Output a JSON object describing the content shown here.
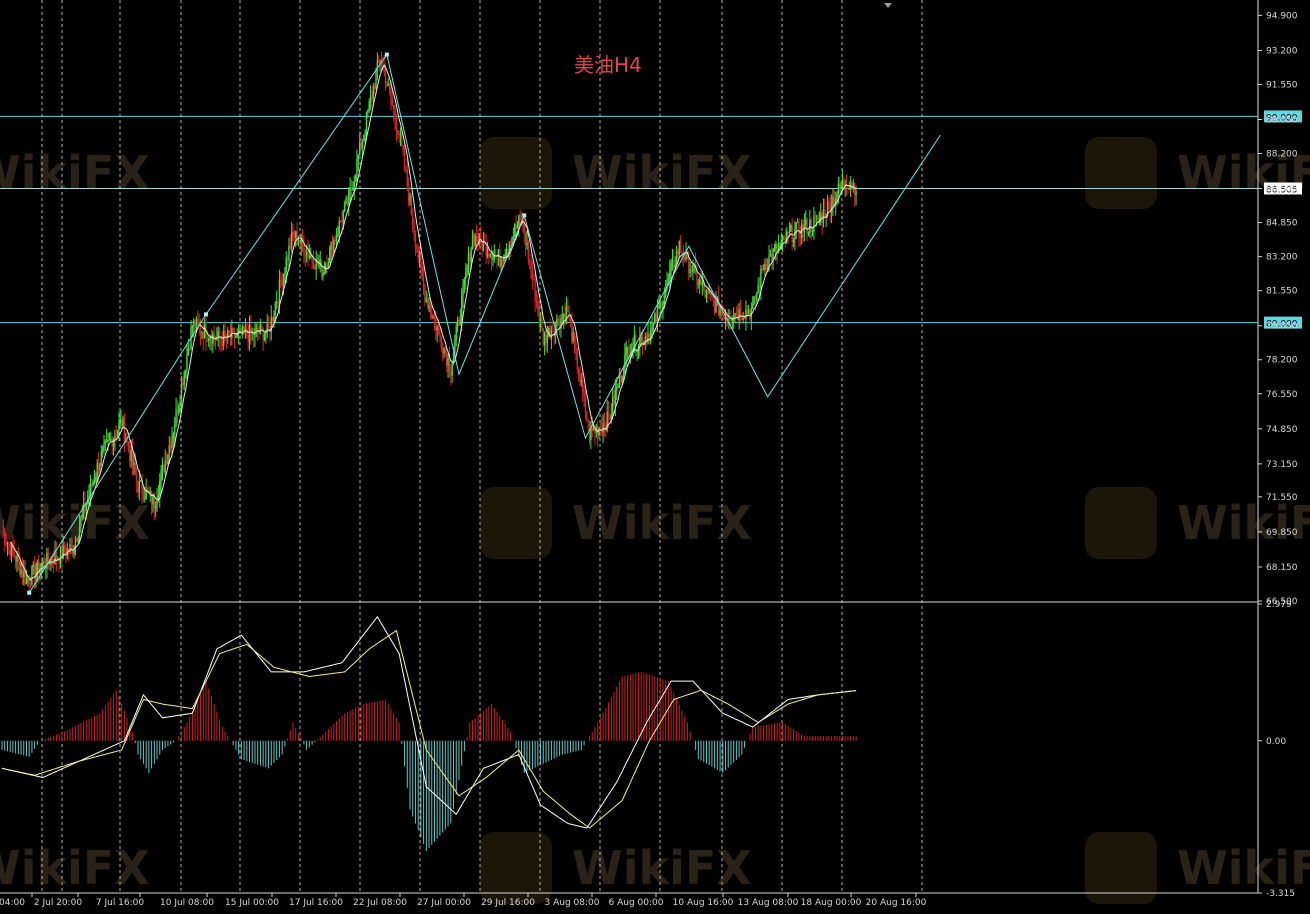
{
  "chart_data": {
    "type": "candlestick",
    "title": "美油H4",
    "colors": {
      "bull": "#3fe13a",
      "bear": "#e0202a",
      "zigzag": "#67e6e6",
      "ma": "#d7f5d7",
      "hline": "#5fd6e0",
      "grid": "#d0d0d0",
      "histogram_pos": "#d11e1e",
      "histogram_neg": "#5ec8c8",
      "macd": "#ffffff",
      "signal": "#f5f08a"
    },
    "price_axis": {
      "ticks": [
        "94.900",
        "93.200",
        "91.550",
        "89.850",
        "88.200",
        "86.505",
        "84.850",
        "83.200",
        "81.550",
        "79.850",
        "78.200",
        "76.550",
        "74.850",
        "73.150",
        "71.550",
        "69.850",
        "68.150",
        "66.500"
      ],
      "range": [
        66.5,
        95.5
      ]
    },
    "horizontal_lines": [
      {
        "value": 90.0,
        "label": "90.000"
      },
      {
        "value": 86.505,
        "label": "86.505"
      },
      {
        "value": 80.0,
        "label": "80.000"
      }
    ],
    "time_axis": {
      "labels": [
        "04:00",
        "2 Jul 20:00",
        "7 Jul 16:00",
        "10 Jul 08:00",
        "15 Jul 00:00",
        "17 Jul 16:00",
        "22 Jul 08:00",
        "27 Jul 00:00",
        "29 Jul 16:00",
        "3 Aug 08:00",
        "6 Aug 00:00",
        "10 Aug 16:00",
        "13 Aug 08:00",
        "18 Aug 00:00",
        "20 Aug 16:00"
      ],
      "label_positions": [
        0,
        24,
        72,
        120,
        168,
        216,
        264,
        312,
        360,
        408,
        456,
        504,
        552,
        600,
        648
      ]
    },
    "price_swings": [
      [
        0,
        69.9
      ],
      [
        18,
        67.5
      ],
      [
        30,
        68.3
      ],
      [
        52,
        69.1
      ],
      [
        72,
        73.4
      ],
      [
        88,
        75.2
      ],
      [
        100,
        72.1
      ],
      [
        112,
        71.3
      ],
      [
        126,
        74.8
      ],
      [
        140,
        79.9
      ],
      [
        160,
        79.2
      ],
      [
        196,
        79.6
      ],
      [
        214,
        84.3
      ],
      [
        236,
        82.5
      ],
      [
        256,
        86.2
      ],
      [
        278,
        92.9
      ],
      [
        292,
        89.2
      ],
      [
        310,
        81.6
      ],
      [
        330,
        77.8
      ],
      [
        346,
        84.2
      ],
      [
        366,
        83.1
      ],
      [
        382,
        85.1
      ],
      [
        398,
        79.2
      ],
      [
        416,
        80.6
      ],
      [
        432,
        74.6
      ],
      [
        446,
        75.3
      ],
      [
        460,
        78.7
      ],
      [
        478,
        79.6
      ],
      [
        498,
        83.7
      ],
      [
        518,
        81.3
      ],
      [
        532,
        80.4
      ],
      [
        552,
        80.6
      ],
      [
        560,
        82.8
      ],
      [
        580,
        84.3
      ],
      [
        600,
        84.9
      ],
      [
        620,
        86.9
      ],
      [
        628,
        86.6
      ]
    ],
    "zigzag": [
      [
        20,
        66.9
      ],
      [
        150,
        80.4
      ],
      [
        283,
        93.0
      ],
      [
        336,
        77.5
      ],
      [
        384,
        85.2
      ],
      [
        429,
        74.4
      ],
      [
        505,
        83.7
      ],
      [
        563,
        76.4
      ],
      [
        690,
        89.1
      ]
    ],
    "zigzag_markers": [
      [
        20,
        66.9
      ],
      [
        150,
        80.4
      ],
      [
        283,
        93.0
      ],
      [
        384,
        85.2
      ]
    ],
    "oscillator": {
      "type": "MACD",
      "axis_ticks": [
        "2.979",
        "0.00",
        "-3.315"
      ],
      "range": [
        -3.315,
        2.979
      ],
      "macd_swings": [
        [
          0,
          -0.6
        ],
        [
          30,
          -0.8
        ],
        [
          60,
          -0.4
        ],
        [
          90,
          0.0
        ],
        [
          104,
          1.0
        ],
        [
          118,
          0.5
        ],
        [
          140,
          0.6
        ],
        [
          158,
          2.0
        ],
        [
          176,
          2.3
        ],
        [
          198,
          1.5
        ],
        [
          222,
          1.5
        ],
        [
          250,
          1.7
        ],
        [
          276,
          2.7
        ],
        [
          292,
          1.9
        ],
        [
          312,
          -1.0
        ],
        [
          334,
          -1.6
        ],
        [
          354,
          -0.6
        ],
        [
          380,
          -0.3
        ],
        [
          396,
          -1.4
        ],
        [
          416,
          -1.8
        ],
        [
          430,
          -1.9
        ],
        [
          452,
          -0.9
        ],
        [
          474,
          0.4
        ],
        [
          492,
          1.3
        ],
        [
          508,
          1.3
        ],
        [
          530,
          0.6
        ],
        [
          552,
          0.3
        ],
        [
          578,
          0.9
        ],
        [
          600,
          1.0
        ],
        [
          630,
          1.1
        ]
      ],
      "signal_swings": [
        [
          0,
          -0.6
        ],
        [
          24,
          -0.75
        ],
        [
          56,
          -0.45
        ],
        [
          88,
          -0.2
        ],
        [
          104,
          0.9
        ],
        [
          118,
          0.8
        ],
        [
          140,
          0.7
        ],
        [
          160,
          1.9
        ],
        [
          180,
          2.1
        ],
        [
          200,
          1.6
        ],
        [
          226,
          1.4
        ],
        [
          252,
          1.5
        ],
        [
          270,
          2.0
        ],
        [
          290,
          2.4
        ],
        [
          312,
          -0.2
        ],
        [
          336,
          -1.2
        ],
        [
          356,
          -0.8
        ],
        [
          380,
          -0.2
        ],
        [
          398,
          -1.1
        ],
        [
          418,
          -1.6
        ],
        [
          432,
          -1.9
        ],
        [
          456,
          -1.3
        ],
        [
          476,
          0.0
        ],
        [
          494,
          0.9
        ],
        [
          514,
          1.1
        ],
        [
          534,
          0.8
        ],
        [
          556,
          0.4
        ],
        [
          578,
          0.8
        ],
        [
          600,
          1.0
        ],
        [
          630,
          1.1
        ]
      ],
      "hist_segments": [
        [
          0,
          -0.2
        ],
        [
          20,
          -0.35
        ],
        [
          28,
          0.0
        ],
        [
          46,
          0.2
        ],
        [
          72,
          0.6
        ],
        [
          84,
          1.1
        ],
        [
          96,
          0.2
        ],
        [
          100,
          -0.3
        ],
        [
          108,
          -0.7
        ],
        [
          118,
          -0.2
        ],
        [
          128,
          0.0
        ],
        [
          136,
          0.4
        ],
        [
          150,
          1.3
        ],
        [
          162,
          0.3
        ],
        [
          176,
          -0.4
        ],
        [
          196,
          -0.6
        ],
        [
          206,
          -0.3
        ],
        [
          214,
          0.4
        ],
        [
          224,
          -0.2
        ],
        [
          238,
          0.2
        ],
        [
          252,
          0.6
        ],
        [
          266,
          0.8
        ],
        [
          282,
          0.9
        ],
        [
          292,
          0.4
        ],
        [
          300,
          -1.5
        ],
        [
          312,
          -2.4
        ],
        [
          330,
          -1.8
        ],
        [
          344,
          0.4
        ],
        [
          360,
          0.8
        ],
        [
          374,
          0.2
        ],
        [
          384,
          -0.7
        ],
        [
          398,
          -0.5
        ],
        [
          412,
          -0.3
        ],
        [
          426,
          -0.2
        ],
        [
          440,
          0.5
        ],
        [
          456,
          1.4
        ],
        [
          470,
          1.5
        ],
        [
          490,
          1.3
        ],
        [
          504,
          0.4
        ],
        [
          512,
          -0.4
        ],
        [
          530,
          -0.7
        ],
        [
          544,
          -0.3
        ],
        [
          552,
          0.3
        ],
        [
          574,
          0.4
        ],
        [
          590,
          0.1
        ],
        [
          610,
          0.1
        ],
        [
          630,
          0.1
        ]
      ]
    },
    "watermark": "WikiFX"
  }
}
